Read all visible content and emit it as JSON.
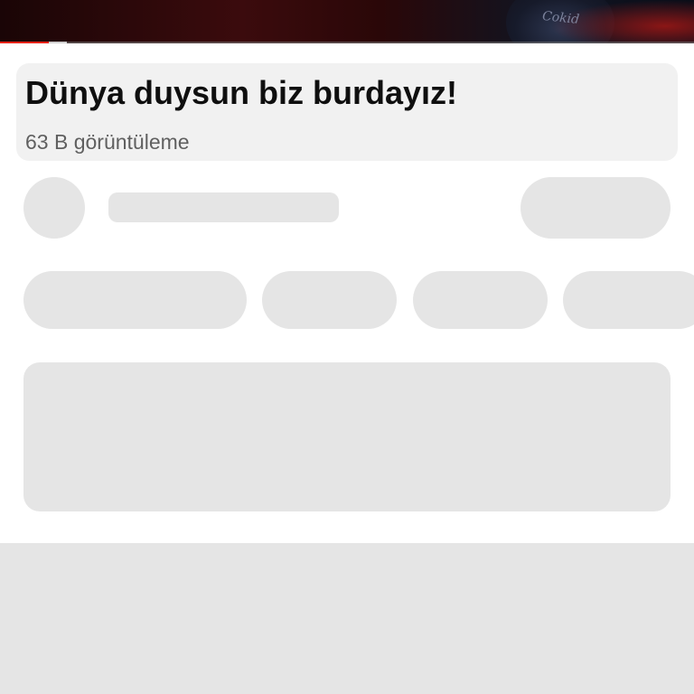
{
  "player": {
    "brand_watermark": "Cokid",
    "progress_played": 0.07,
    "progress_buffered": 0.096,
    "accent_color": "#e62117"
  },
  "video": {
    "title": "Dünya duysun biz burdayız!",
    "views": "63 B görüntüleme"
  },
  "placeholders": {
    "state": "loading",
    "color": "#e5e5e5"
  }
}
